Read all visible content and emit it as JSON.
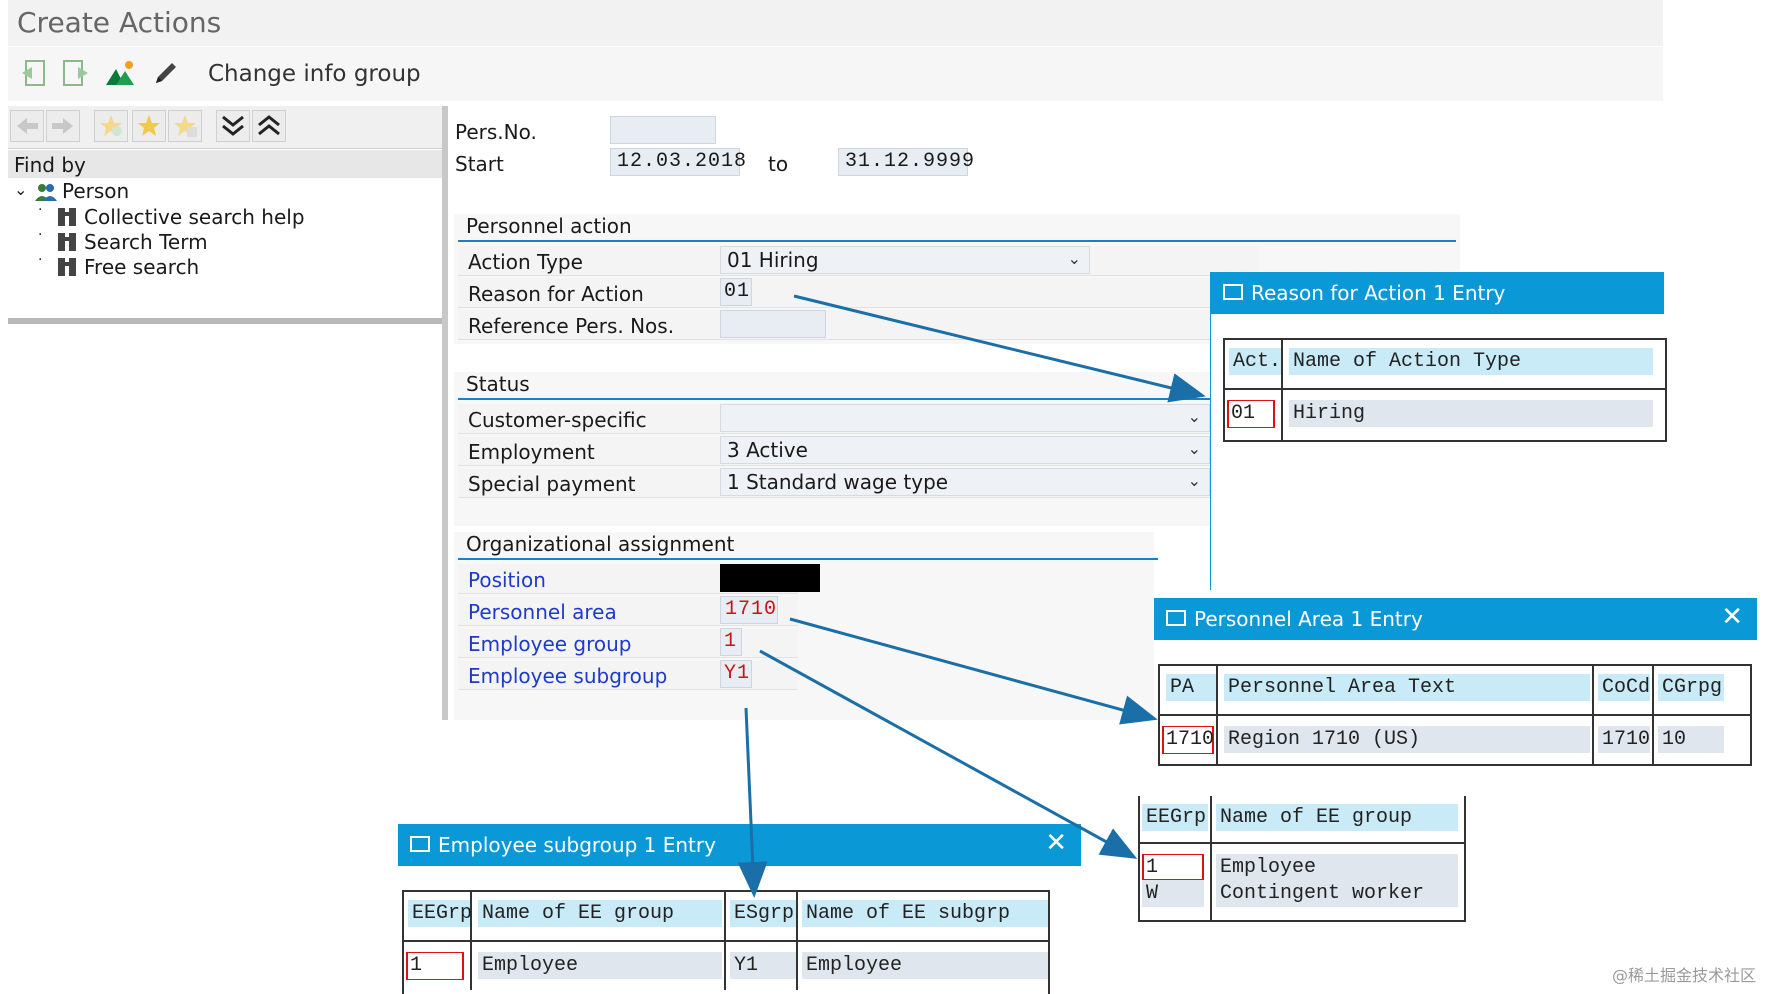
{
  "window": {
    "title": "Create Actions"
  },
  "toolbar": {
    "change_info_group": "Change info group"
  },
  "left_panel": {
    "find_by": "Find by",
    "tree": [
      "Person",
      "Collective search help",
      "Search Term",
      "Free search"
    ]
  },
  "header": {
    "pers_no_label": "Pers.No.",
    "start_label": "Start",
    "start_value": "12.03.2018",
    "to_label": "to",
    "to_value": "31.12.9999"
  },
  "personnel_action": {
    "heading": "Personnel action",
    "action_type_label": "Action Type",
    "action_type_value": "01 Hiring",
    "reason_label": "Reason for Action",
    "reason_value": "01",
    "ref_label": "Reference Pers. Nos."
  },
  "status": {
    "heading": "Status",
    "customer_label": "Customer-specific",
    "employment_label": "Employment",
    "employment_value": "3 Active",
    "special_label": "Special payment",
    "special_value": "1 Standard wage type"
  },
  "org": {
    "heading": "Organizational assignment",
    "position_label": "Position",
    "pa_label": "Personnel area",
    "pa_value": "1710",
    "eg_label": "Employee group",
    "eg_value": "1",
    "esg_label": "Employee subgroup",
    "esg_value": "Y1"
  },
  "popup_reason": {
    "title": "Reason for Action 1 Entry",
    "col1": "Act.",
    "col2": "Name of Action Type",
    "row_code": "01",
    "row_name": "Hiring"
  },
  "popup_pa": {
    "title": "Personnel Area 1 Entry",
    "cols": [
      "PA",
      "Personnel Area Text",
      "CoCd",
      "CGrpg"
    ],
    "row": [
      "1710",
      "Region 1710 (US)",
      "1710",
      "10"
    ]
  },
  "popup_eegroup": {
    "cols": [
      "EEGrp",
      "Name of EE group"
    ],
    "rows": [
      [
        "1",
        "Employee"
      ],
      [
        "W",
        "Contingent worker"
      ]
    ]
  },
  "popup_subgroup": {
    "title": "Employee subgroup 1 Entry",
    "cols": [
      "EEGrp",
      "Name of EE group",
      "ESgrp",
      "Name of EE subgrp"
    ],
    "row": [
      "1",
      "Employee",
      "Y1",
      "Employee"
    ]
  },
  "watermark": "@稀土掘金技术社区",
  "colors": {
    "accent": "#0a99d6",
    "link": "#1f3ac9",
    "arrow": "#1b6fa8",
    "error": "#c41616"
  }
}
